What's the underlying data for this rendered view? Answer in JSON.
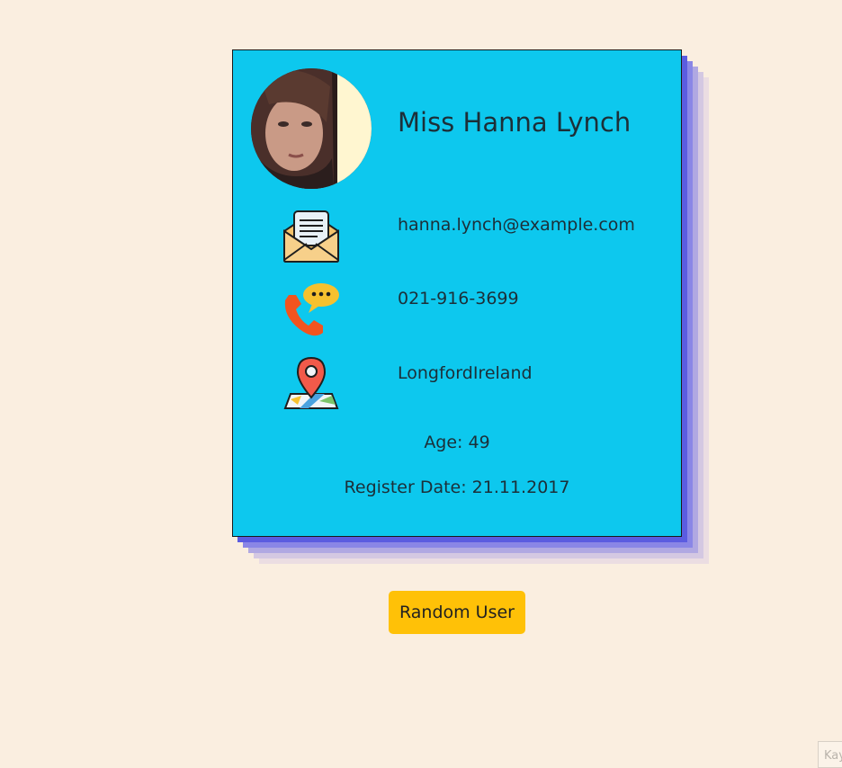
{
  "user": {
    "name": "Miss Hanna Lynch",
    "email": "hanna.lynch@example.com",
    "phone": "021-916-3699",
    "location": "LongfordIreland",
    "age_text": "Age: 49",
    "register_text": "Register Date: 21.11.2017"
  },
  "icons": {
    "email": "envelope-icon",
    "phone": "phone-chat-icon",
    "location": "map-pin-icon"
  },
  "actions": {
    "random_user_label": "Random User"
  },
  "corner": {
    "text": "Kay"
  },
  "colors": {
    "background": "#faeee0",
    "card": "#0dc8ee",
    "button": "#ffc107",
    "shadow": "#5b5ce0"
  }
}
